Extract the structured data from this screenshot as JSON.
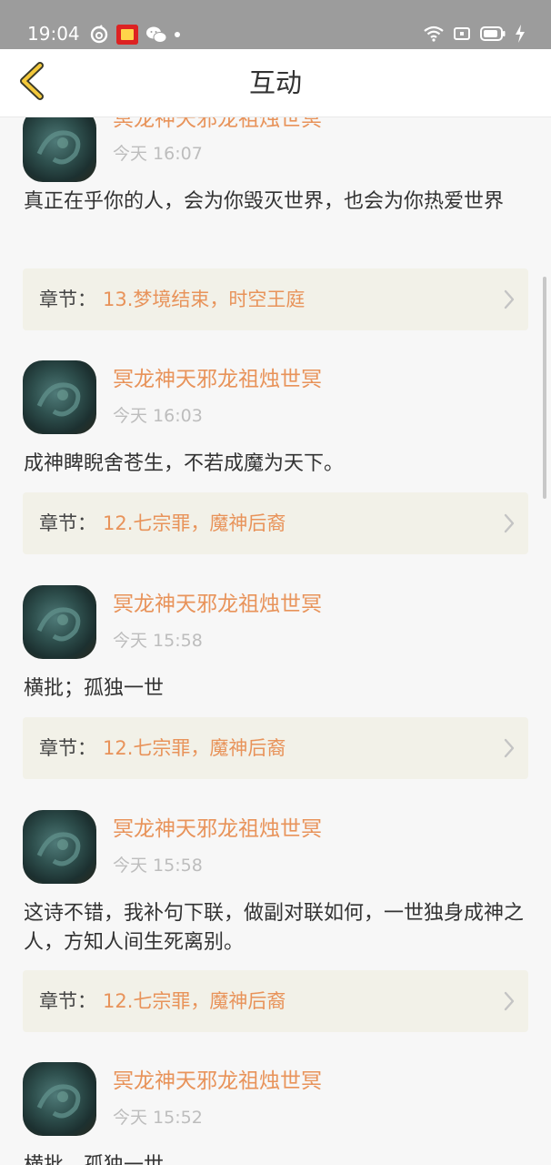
{
  "status_bar": {
    "time": "19:04",
    "left_icons": [
      "netease-music-icon",
      "app-badge-icon",
      "wechat-icon",
      "notification-dot-icon"
    ],
    "right_icons": [
      "wifi-icon",
      "screen-cast-icon",
      "battery-icon",
      "charging-icon"
    ]
  },
  "header": {
    "back_icon": "chevron-left-icon",
    "title": "互动"
  },
  "posts": [
    {
      "username": "冥龙神天邪龙祖烛世冥",
      "time": "今天 16:07",
      "comment": "真正在乎你的人，会为你毁灭世界，也会为你热爱世界",
      "chapter_label": "章节：",
      "chapter_title": "13.梦境结束，时空王庭"
    },
    {
      "username": "冥龙神天邪龙祖烛世冥",
      "time": "今天 16:03",
      "comment": "成神睥睨舍苍生，不若成魔为天下。",
      "chapter_label": "章节：",
      "chapter_title": "12.七宗罪，魔神后裔"
    },
    {
      "username": "冥龙神天邪龙祖烛世冥",
      "time": "今天 15:58",
      "comment": "横批；孤独一世",
      "chapter_label": "章节：",
      "chapter_title": "12.七宗罪，魔神后裔"
    },
    {
      "username": "冥龙神天邪龙祖烛世冥",
      "time": "今天 15:58",
      "comment": "这诗不错，我补句下联，做副对联如何，一世独身成神之人，方知人间生死离别。",
      "chapter_label": "章节：",
      "chapter_title": "12.七宗罪，魔神后裔"
    },
    {
      "username": "冥龙神天邪龙祖烛世冥",
      "time": "今天 15:52",
      "comment": "横批，孤独一世"
    }
  ],
  "colors": {
    "accent": "#e8935a",
    "chapter_bg": "#f2f1e8",
    "status_bar_bg": "#9c9c9c"
  }
}
